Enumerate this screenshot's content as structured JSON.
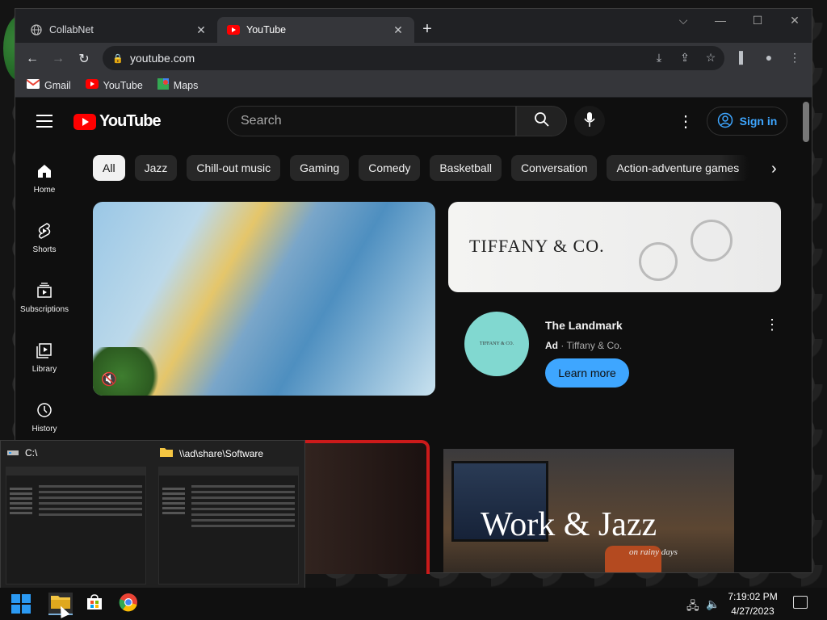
{
  "browser": {
    "tabs": [
      {
        "title": "CollabNet",
        "favicon": "globe-icon",
        "active": false
      },
      {
        "title": "YouTube",
        "favicon": "youtube-icon",
        "active": true
      }
    ],
    "new_tab": "+",
    "window_controls": {
      "tab_search": "⌵",
      "minimize": "—",
      "maximize": "☐",
      "close": "✕"
    },
    "url": "youtube.com",
    "bookmarks": [
      {
        "label": "Gmail",
        "icon": "gmail-icon"
      },
      {
        "label": "YouTube",
        "icon": "youtube-icon"
      },
      {
        "label": "Maps",
        "icon": "maps-icon"
      }
    ]
  },
  "youtube": {
    "logo_text": "YouTube",
    "search_placeholder": "Search",
    "sign_in": "Sign in",
    "guide": [
      {
        "label": "Home",
        "icon": "home-icon"
      },
      {
        "label": "Shorts",
        "icon": "shorts-icon"
      },
      {
        "label": "Subscriptions",
        "icon": "subscriptions-icon"
      },
      {
        "label": "Library",
        "icon": "library-icon"
      },
      {
        "label": "History",
        "icon": "history-icon"
      }
    ],
    "chips": [
      "All",
      "Jazz",
      "Chill-out music",
      "Gaming",
      "Comedy",
      "Basketball",
      "Conversation",
      "Action-adventure games"
    ],
    "ad": {
      "banner_brand": "TIFFANY & CO.",
      "avatar_text": "TIFFANY & CO.",
      "title": "The Landmark",
      "ad_label": "Ad",
      "sponsor": "Tiffany & Co.",
      "cta": "Learn more"
    },
    "thumbnail_text": {
      "main": "Work & Jazz",
      "sub": "on rainy days"
    }
  },
  "taskbar_preview": [
    {
      "title": "C:\\",
      "icon": "drive-icon"
    },
    {
      "title": "\\\\ad\\share\\Software",
      "icon": "folder-icon"
    }
  ],
  "taskbar": {
    "time": "7:19:02 PM",
    "date": "4/27/2023"
  },
  "colors": {
    "yt_red": "#ff0000",
    "link_blue": "#3ea6ff",
    "tiffany_blue": "#81d8d0"
  }
}
